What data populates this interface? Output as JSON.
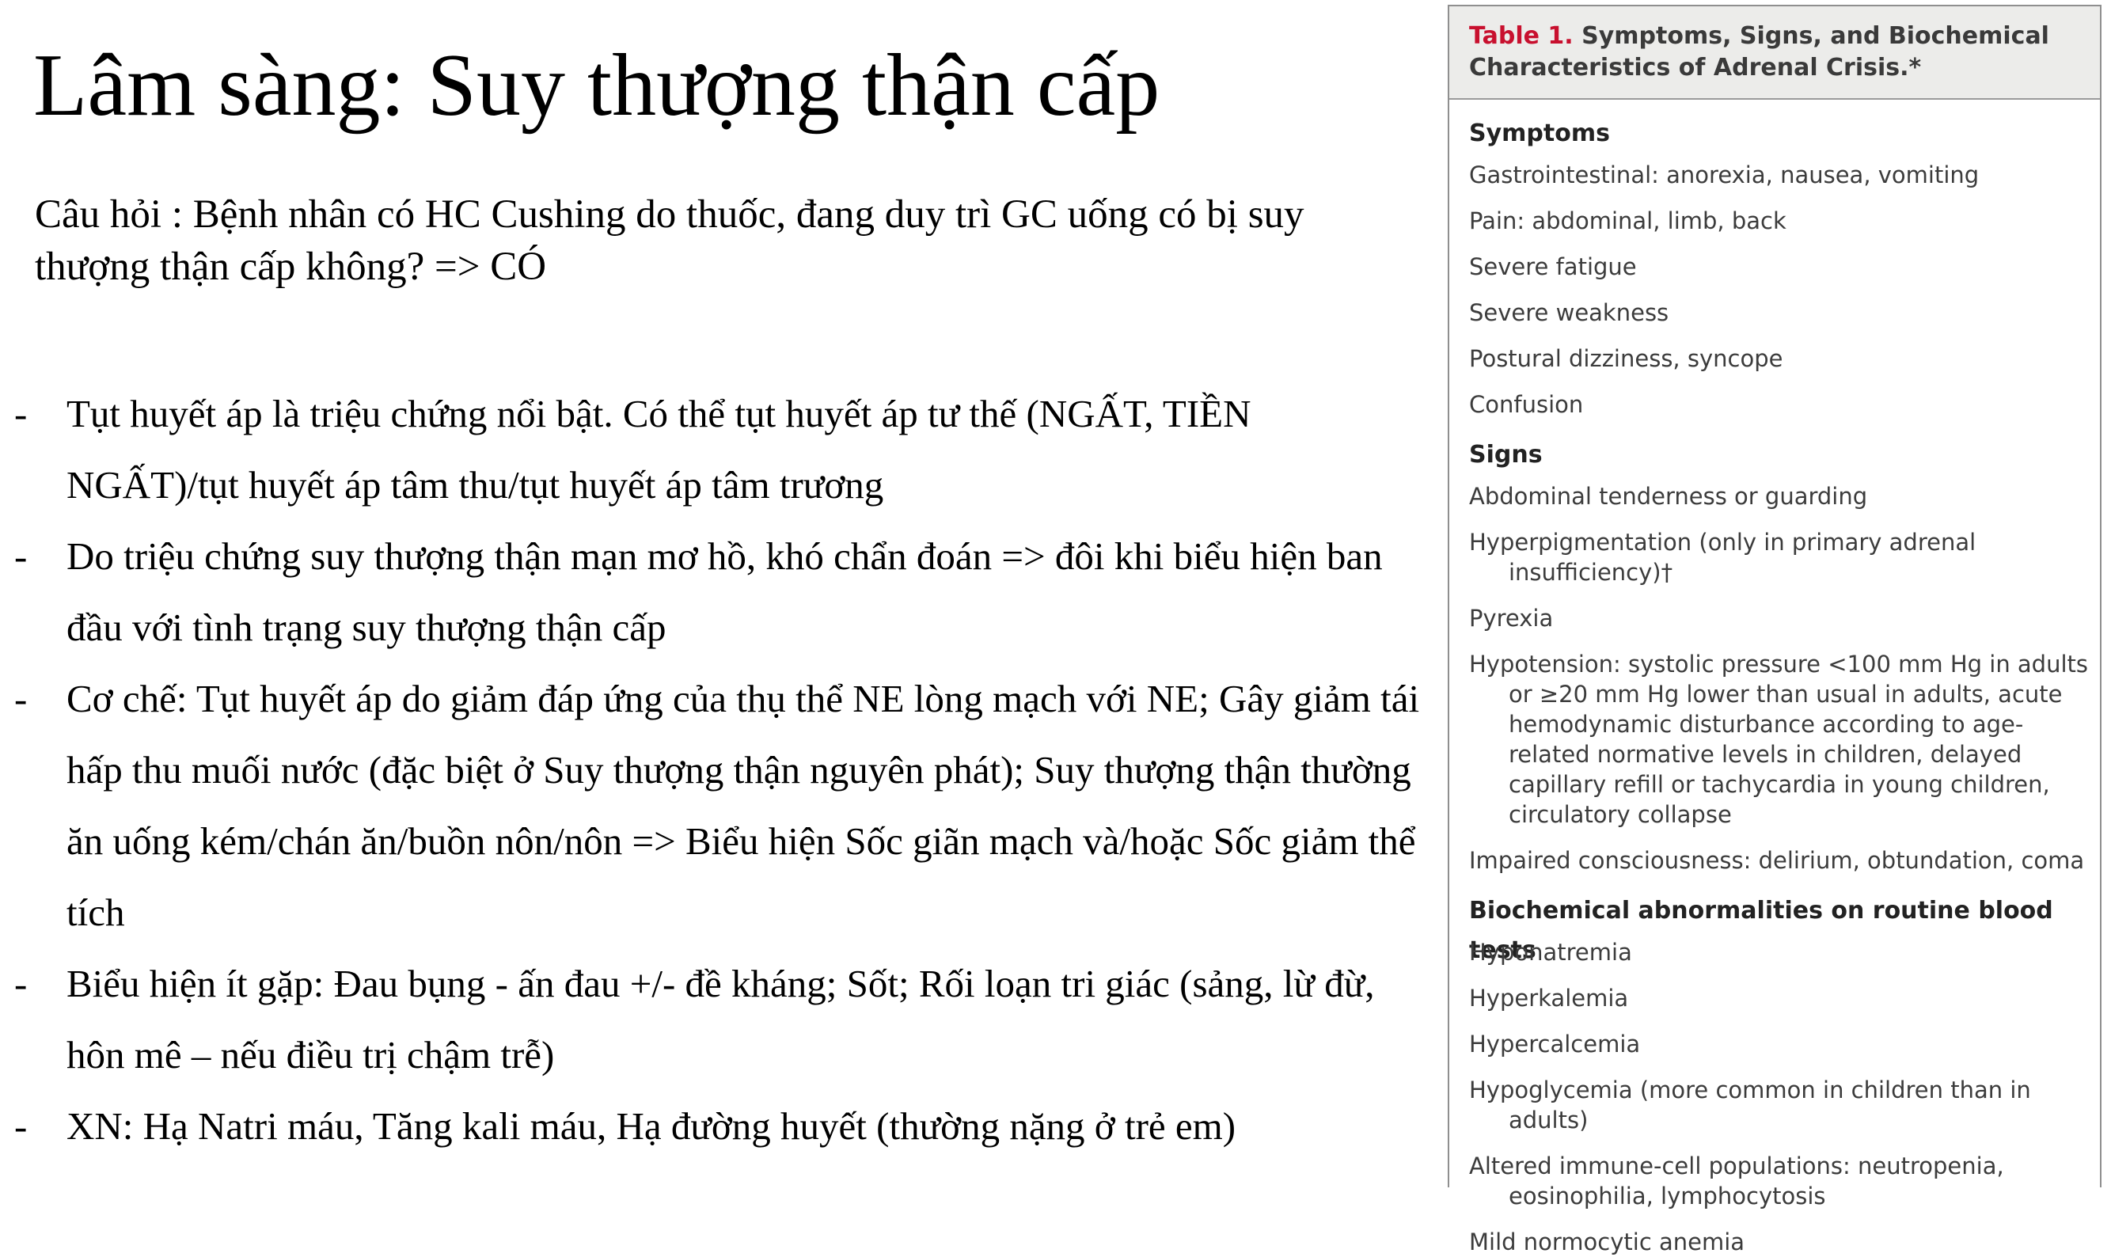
{
  "slide": {
    "title": "Lâm sàng: Suy thượng thận cấp",
    "question": "Câu hỏi : Bệnh nhân có HC Cushing do thuốc, đang duy trì GC uống có bị suy thượng thận cấp không? => CÓ",
    "bullets": [
      {
        "marker": "-",
        "text": "Tụt huyết áp là triệu chứng nổi bật. Có thể tụt huyết áp tư thế  (NGẤT, TIỀN NGẤT)/tụt huyết áp tâm thu/tụt huyết áp tâm trương"
      },
      {
        "marker": "-",
        "text": "Do triệu chứng suy thượng thận mạn mơ hồ, khó chẩn đoán => đôi khi biểu hiện ban đầu với tình trạng suy thượng thận cấp"
      },
      {
        "marker": "-",
        "text": "Cơ chế: Tụt huyết áp do giảm đáp ứng của thụ thể NE lòng mạch với NE; Gây giảm tái hấp thu muối nước (đặc biệt ở Suy thượng thận nguyên phát); Suy thượng thận thường ăn uống kém/chán ăn/buồn nôn/nôn => Biểu hiện Sốc giãn mạch và/hoặc Sốc giảm thể tích"
      },
      {
        "marker": "-",
        "text": "Biểu hiện ít gặp: Đau bụng - ấn đau +/- đề kháng; Sốt; Rối loạn tri giác (sảng, lừ đừ, hôn mê – nếu điều trị chậm trễ)"
      },
      {
        "marker": "-",
        "text": "XN: Hạ Natri máu, Tăng kali máu, Hạ đường huyết (thường nặng ở trẻ em)"
      }
    ]
  },
  "table": {
    "number": "Table 1.",
    "title": "Symptoms, Signs, and Biochemical Characteristics of Adrenal Crisis.*",
    "sections": [
      {
        "heading": "Symptoms",
        "items": [
          "Gastrointestinal: anorexia, nausea, vomiting",
          "Pain: abdominal, limb, back",
          "Severe fatigue",
          "Severe weakness",
          "Postural dizziness, syncope",
          "Confusion"
        ]
      },
      {
        "heading": "Signs",
        "items": [
          "Abdominal tenderness or guarding",
          "Hyperpigmentation (only in primary adrenal insufficiency)†",
          "Pyrexia",
          "Hypotension: systolic pressure <100 mm Hg in adults or ≥20 mm Hg lower than usual in adults, acute hemodynamic disturbance according to age-related normative levels in children, delayed capillary refill or tachycardia in young children, circulatory collapse",
          "Impaired consciousness: delirium, obtundation, coma"
        ]
      },
      {
        "heading": "Biochemical abnormalities on routine blood tests",
        "items": [
          "Hyponatremia",
          "Hyperkalemia",
          "Hypercalcemia",
          "Hypoglycemia (more common in children than in adults)",
          "Altered immune-cell populations: neutropenia, eosinophilia, lymphocytosis",
          "Mild normocytic anemia"
        ]
      }
    ]
  }
}
